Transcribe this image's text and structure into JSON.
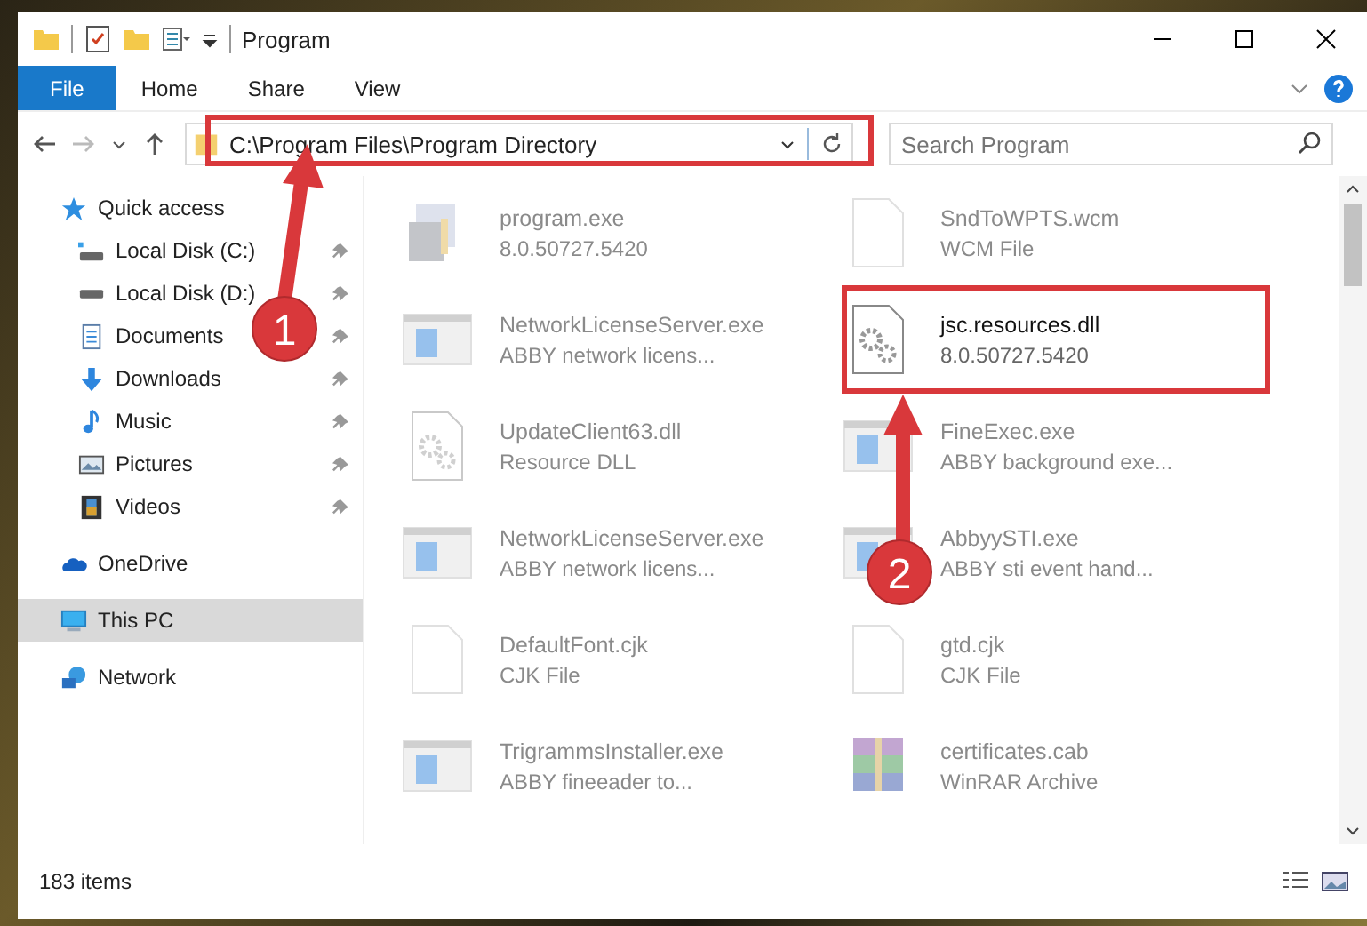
{
  "window": {
    "title": "Program"
  },
  "ribbon_tabs": [
    {
      "label": "File",
      "selected": true
    },
    {
      "label": "Home",
      "selected": false
    },
    {
      "label": "Share",
      "selected": false
    },
    {
      "label": "View",
      "selected": false
    }
  ],
  "address_bar": {
    "path": "C:\\Program Files\\Program Directory"
  },
  "search": {
    "placeholder": "Search Program"
  },
  "sidebar": {
    "items": [
      {
        "label": "Quick access",
        "kind": "star",
        "selected": false,
        "children": [
          {
            "label": "Local Disk (C:)",
            "kind": "drive-c",
            "pinned": true,
            "selected": false
          },
          {
            "label": "Local Disk (D:)",
            "kind": "drive",
            "pinned": true,
            "selected": false
          },
          {
            "label": "Documents",
            "kind": "documents",
            "pinned": true,
            "selected": false
          },
          {
            "label": "Downloads",
            "kind": "downloads",
            "pinned": true,
            "selected": false
          },
          {
            "label": "Music",
            "kind": "music",
            "pinned": true,
            "selected": false
          },
          {
            "label": "Pictures",
            "kind": "pictures",
            "pinned": true,
            "selected": false
          },
          {
            "label": "Videos",
            "kind": "videos",
            "pinned": true,
            "selected": false
          }
        ]
      },
      {
        "label": "OneDrive",
        "kind": "cloud",
        "selected": false
      },
      {
        "label": "This PC",
        "kind": "pc",
        "selected": true
      },
      {
        "label": "Network",
        "kind": "network",
        "selected": false
      }
    ]
  },
  "files": [
    {
      "name": "program.exe",
      "detail": "8.0.50727.5420",
      "kind": "installer",
      "faded": true
    },
    {
      "name": "SndToWPTS.wcm",
      "detail": "WCM File",
      "kind": "file",
      "faded": true
    },
    {
      "name": "NetworkLicenseServer.exe",
      "detail": "ABBY network licens...",
      "kind": "app",
      "faded": true
    },
    {
      "name": "jsc.resources.dll",
      "detail": "8.0.50727.5420",
      "kind": "gear-file",
      "faded": false
    },
    {
      "name": "UpdateClient63.dll",
      "detail": "Resource DLL",
      "kind": "gear-file",
      "faded": true
    },
    {
      "name": "FineExec.exe",
      "detail": "ABBY background exe...",
      "kind": "app",
      "faded": true
    },
    {
      "name": "NetworkLicenseServer.exe",
      "detail": "ABBY network licens...",
      "kind": "app",
      "faded": true
    },
    {
      "name": "AbbyySTI.exe",
      "detail": "ABBY sti event hand...",
      "kind": "app",
      "faded": true
    },
    {
      "name": "DefaultFont.cjk",
      "detail": "CJK File",
      "kind": "file",
      "faded": true
    },
    {
      "name": "gtd.cjk",
      "detail": "CJK File",
      "kind": "file",
      "faded": true
    },
    {
      "name": "TrigrammsInstaller.exe",
      "detail": "ABBY fineeader to...",
      "kind": "app",
      "faded": true
    },
    {
      "name": "certificates.cab",
      "detail": "WinRAR Archive",
      "kind": "archive",
      "faded": true
    }
  ],
  "status_bar": {
    "count": "183 items"
  },
  "annotations": [
    {
      "number": "1"
    },
    {
      "number": "2"
    }
  ]
}
